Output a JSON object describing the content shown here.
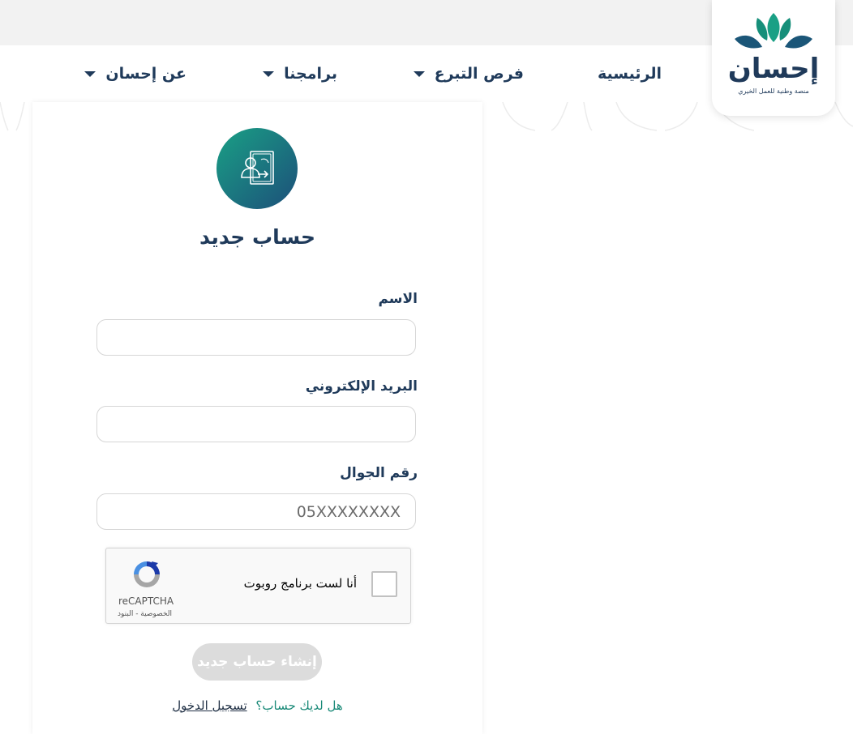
{
  "logo": {
    "word": "إحسان",
    "tagline": "منصة وطنية للعمل الخيري"
  },
  "nav": {
    "items": [
      {
        "label": "الرئيسية",
        "dropdown": false
      },
      {
        "label": "فرص التبرع",
        "dropdown": true
      },
      {
        "label": "برامجنا",
        "dropdown": true
      },
      {
        "label": "عن إحسان",
        "dropdown": true
      }
    ]
  },
  "form": {
    "title": "حساب جديد",
    "name_label": "الاسم",
    "name_value": "",
    "email_label": "البريد الإلكتروني",
    "email_value": "",
    "phone_label": "رقم الجوال",
    "phone_placeholder": "05XXXXXXXX",
    "submit_label": "إنشاء حساب جديد",
    "have_account_text": "هل لديك حساب؟",
    "login_link": "تسجيل الدخول"
  },
  "captcha": {
    "label": "أنا لست برنامج روبوت",
    "brand": "reCAPTCHA",
    "links": "الخصوصية - البنود"
  },
  "colors": {
    "primary": "#1f3a5a",
    "teal": "#1aa085",
    "button_disabled": "#dcdcdc"
  },
  "icons": {
    "avatar": "user-transfer-icon",
    "caret": "caret-down-icon"
  }
}
